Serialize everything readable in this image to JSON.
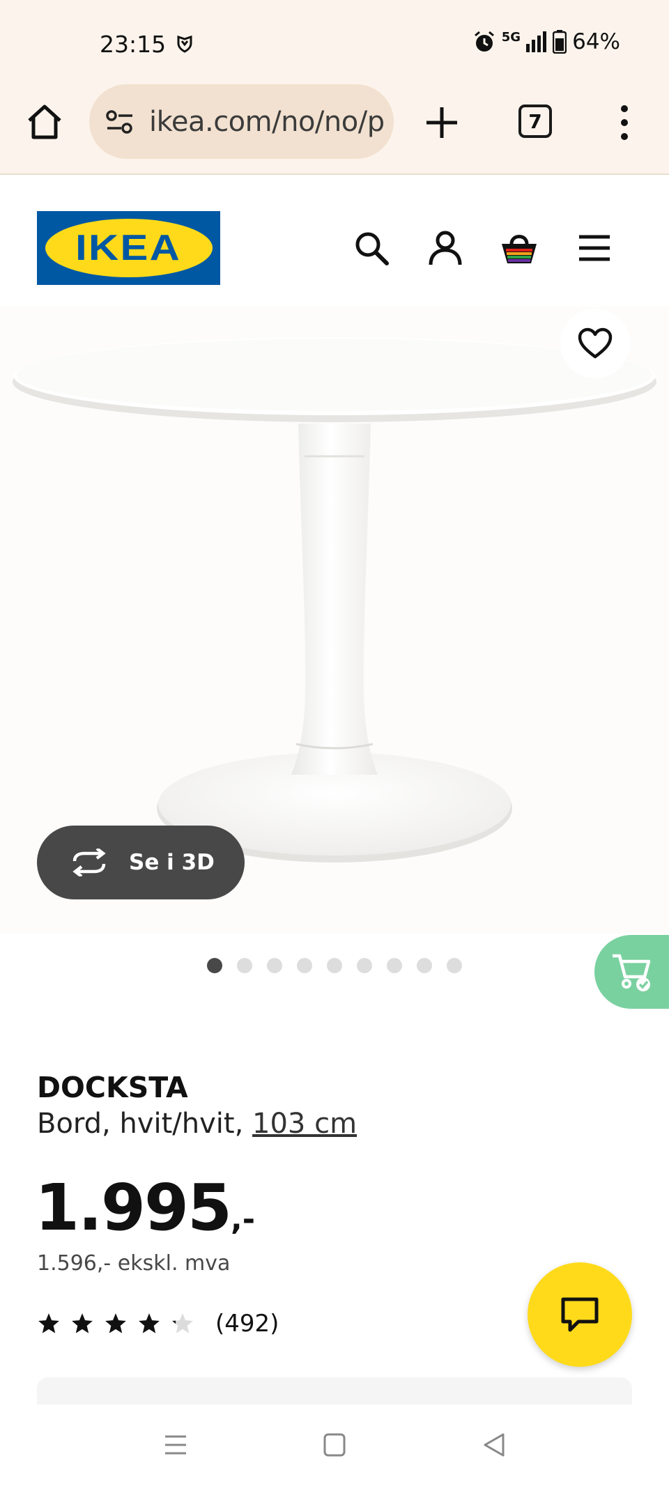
{
  "status_bar": {
    "time": "23:15",
    "network": "5G",
    "battery": "64%"
  },
  "browser": {
    "url": "ikea.com/no/no/p",
    "tab_count": "7"
  },
  "header": {
    "logo_text": "IKEA",
    "icons": [
      "search-icon",
      "account-icon",
      "basket-icon",
      "menu-icon"
    ]
  },
  "gallery": {
    "view_3d_label": "Se i 3D",
    "image_count": 9,
    "active_index": 0
  },
  "product": {
    "name": "DOCKSTA",
    "description": "Bord, hvit/hvit, ",
    "size": "103 cm",
    "price": "1.995",
    "price_suffix": ",-",
    "price_ex_vat": "1.596,- ekskl. mva",
    "rating": 4.2,
    "rating_max": 5,
    "review_count": "(492)"
  },
  "colors": {
    "ikea_blue": "#0058a3",
    "ikea_yellow": "#ffda1a",
    "browser_bg": "#fcf4ec",
    "cart_green": "#7ad1a0"
  }
}
